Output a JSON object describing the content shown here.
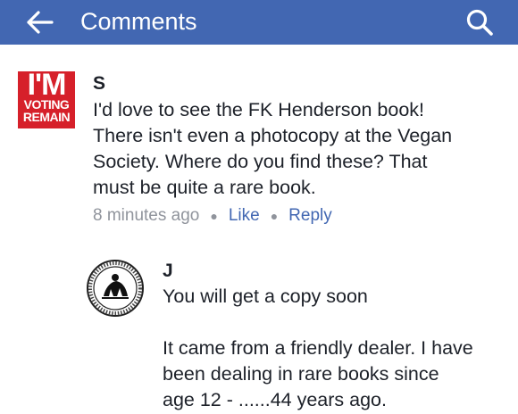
{
  "appbar": {
    "title": "Comments",
    "back_icon": "arrow-left-icon",
    "search_icon": "search-icon",
    "background_color": "#4267b2"
  },
  "comment1": {
    "avatar": {
      "line1": "I'M",
      "line2": "VOTING",
      "line3": "REMAIN",
      "color": "#d6202a"
    },
    "author": "S",
    "text": "I'd love to see the FK Henderson book!\nThere isn't even a photocopy at the Vegan\nSociety. Where do you find these? That\nmust be quite a rare book.",
    "time": "8 minutes ago",
    "like_label": "Like",
    "reply_label": "Reply"
  },
  "comment2": {
    "avatar_icon": "round-seal-logo",
    "author": "J",
    "text": "You will get a copy soon\n\nIt came from a friendly dealer. I have\nbeen dealing in rare books since\nage 12 - ......44 years ago."
  }
}
